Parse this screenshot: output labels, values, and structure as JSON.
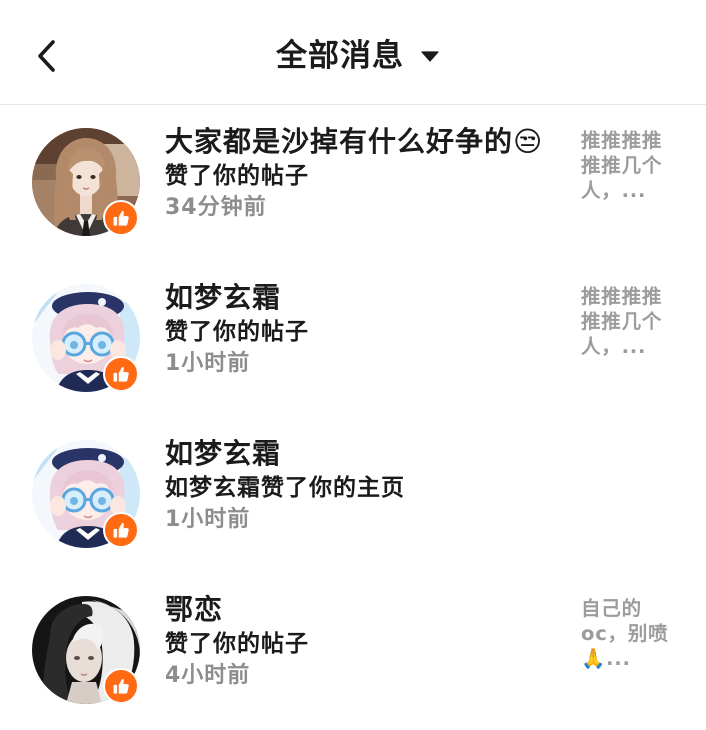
{
  "header": {
    "title": "全部消息"
  },
  "icons": {
    "back": "back-chevron-icon",
    "filter": "dropdown-triangle-icon",
    "like_badge": "thumbs-up-icon"
  },
  "colors": {
    "badge": "#ff6a13",
    "text": "#1b1b1b",
    "muted": "#8d8d8d",
    "preview": "#9c9c9c",
    "divider": "#e6e6e6"
  },
  "notifications": [
    {
      "name": "大家都是沙掉有什么好争的😒",
      "action": "赞了你的帖子",
      "time": "34分钟前",
      "preview": "推推推推推推几个人，..."
    },
    {
      "name": "如梦玄霜",
      "action": "赞了你的帖子",
      "time": "1小时前",
      "preview": "推推推推推推几个人，..."
    },
    {
      "name": "如梦玄霜",
      "action": "如梦玄霜赞了你的主页",
      "time": "1小时前",
      "preview": ""
    },
    {
      "name": "鄂恋",
      "action": "赞了你的帖子",
      "time": "4小时前",
      "preview": "自己的oc，别喷🙏..."
    }
  ]
}
